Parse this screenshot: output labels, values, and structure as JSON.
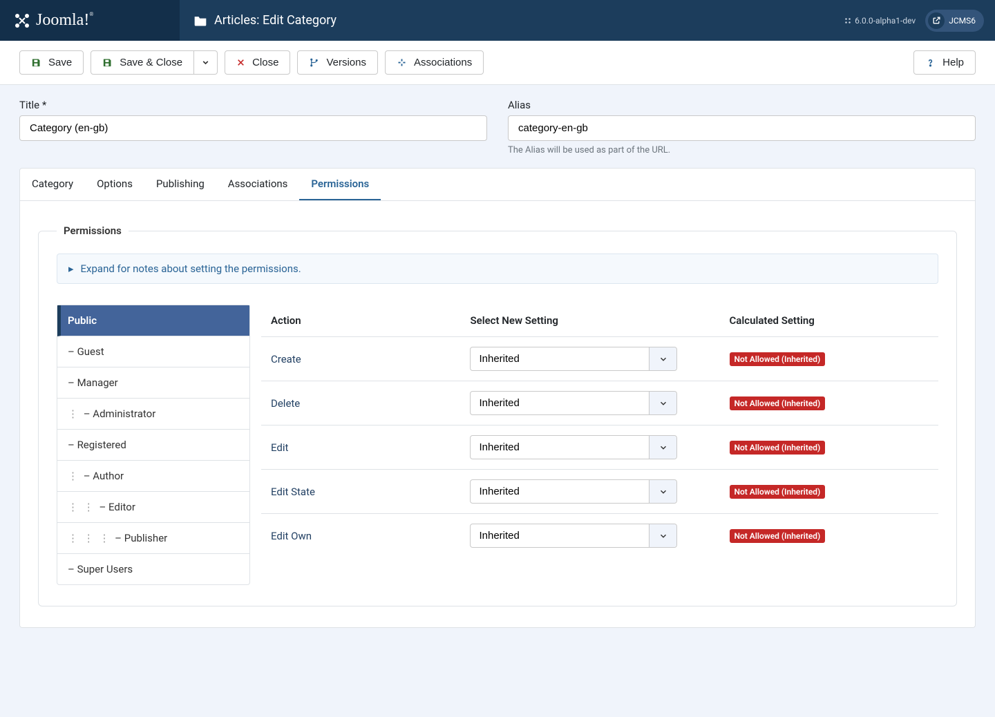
{
  "header": {
    "brand": "Joomla!",
    "page_title": "Articles: Edit Category",
    "version": "6.0.0-alpha1-dev",
    "user": "JCMS6"
  },
  "toolbar": {
    "save": "Save",
    "save_close": "Save & Close",
    "close": "Close",
    "versions": "Versions",
    "associations": "Associations",
    "help": "Help"
  },
  "form": {
    "title_label": "Title *",
    "title_value": "Category (en-gb)",
    "alias_label": "Alias",
    "alias_value": "category-en-gb",
    "alias_help": "The Alias will be used as part of the URL."
  },
  "tabs": {
    "category": "Category",
    "options": "Options",
    "publishing": "Publishing",
    "associations": "Associations",
    "permissions": "Permissions"
  },
  "permissions": {
    "legend": "Permissions",
    "expand_note": "Expand for notes about setting the permissions.",
    "groups": [
      "Public",
      "– Guest",
      "– Manager",
      "– Administrator",
      "– Registered",
      "– Author",
      "– Editor",
      "– Publisher",
      "– Super Users"
    ],
    "group_indents": [
      "",
      "",
      "",
      "⋮  ",
      "",
      "⋮  ",
      "⋮  ⋮  ",
      "⋮  ⋮  ⋮  ",
      ""
    ],
    "cols": {
      "action": "Action",
      "setting": "Select New Setting",
      "calculated": "Calculated Setting"
    },
    "actions": [
      "Create",
      "Delete",
      "Edit",
      "Edit State",
      "Edit Own"
    ],
    "select_default": "Inherited",
    "calc_badge": "Not Allowed (Inherited)"
  }
}
